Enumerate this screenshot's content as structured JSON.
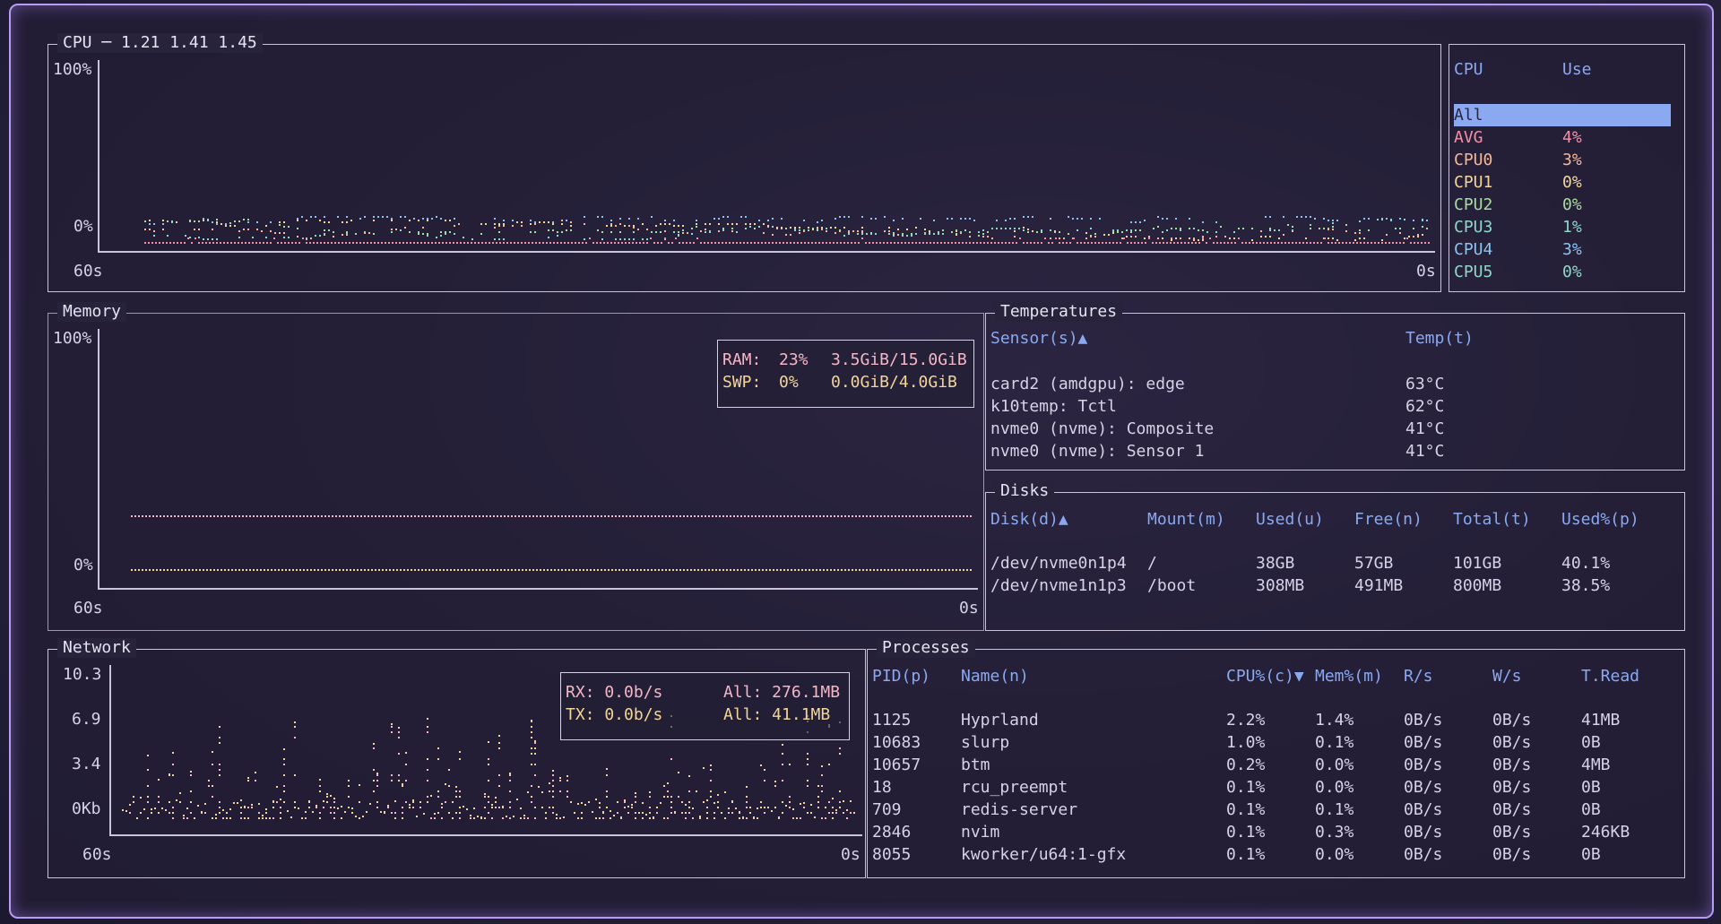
{
  "cpu_panel": {
    "title": "CPU ─ 1.21 1.41 1.45",
    "y_max": "100%",
    "y_min": "0%",
    "x_left": "60s",
    "x_right": "0s"
  },
  "cpu_list": {
    "col_cpu": "CPU",
    "col_use": "Use",
    "rows": [
      {
        "name": "All",
        "use": "",
        "selected": true,
        "color": "#8aa9f0"
      },
      {
        "name": "AVG",
        "use": "4%",
        "color": "#f58fa6"
      },
      {
        "name": "CPU0",
        "use": "3%",
        "color": "#f5b795"
      },
      {
        "name": "CPU1",
        "use": "0%",
        "color": "#f2d59a"
      },
      {
        "name": "CPU2",
        "use": "0%",
        "color": "#a8dca0"
      },
      {
        "name": "CPU3",
        "use": "1%",
        "color": "#8fd7c9"
      },
      {
        "name": "CPU4",
        "use": "3%",
        "color": "#8bc4f0"
      },
      {
        "name": "CPU5",
        "use": "0%",
        "color": "#8fd7c9"
      }
    ]
  },
  "memory_panel": {
    "title": "Memory",
    "y_max": "100%",
    "y_min": "0%",
    "x_left": "60s",
    "x_right": "0s",
    "ram_label": "RAM:",
    "ram_pct": "23%",
    "ram_amount": "3.5GiB/15.0GiB",
    "swp_label": "SWP:",
    "swp_pct": "0%",
    "swp_amount": "0.0GiB/4.0GiB"
  },
  "temps_panel": {
    "title": "Temperatures",
    "col_sensor": "Sensor(s)▲",
    "col_temp": "Temp(t)",
    "rows": [
      {
        "sensor": "card2 (amdgpu): edge",
        "temp": "63°C"
      },
      {
        "sensor": "k10temp: Tctl",
        "temp": "62°C"
      },
      {
        "sensor": "nvme0 (nvme): Composite",
        "temp": "41°C"
      },
      {
        "sensor": "nvme0 (nvme): Sensor 1",
        "temp": "41°C"
      }
    ]
  },
  "disks_panel": {
    "title": "Disks",
    "headers": [
      "Disk(d)▲",
      "Mount(m)",
      "Used(u)",
      "Free(n)",
      "Total(t)",
      "Used%(p)"
    ],
    "rows": [
      [
        "/dev/nvme0n1p4",
        "/",
        "38GB",
        "57GB",
        "101GB",
        "40.1%"
      ],
      [
        "/dev/nvme1n1p3",
        "/boot",
        "308MB",
        "491MB",
        "800MB",
        "38.5%"
      ]
    ]
  },
  "network_panel": {
    "title": "Network",
    "y_ticks": [
      "10.3",
      "6.9",
      "3.4",
      "0Kb"
    ],
    "x_left": "60s",
    "x_right": "0s",
    "rx_label": "RX: 0.0b/s",
    "rx_all": "All: 276.1MB",
    "tx_label": "TX: 0.0b/s",
    "tx_all": "All: 41.1MB"
  },
  "processes_panel": {
    "title": "Processes",
    "headers": [
      "PID(p)",
      "Name(n)",
      "CPU%(c)▼",
      "Mem%(m)",
      "R/s",
      "W/s",
      "T.Read"
    ],
    "rows": [
      [
        "1125",
        "Hyprland",
        "2.2%",
        "1.4%",
        "0B/s",
        "0B/s",
        "41MB"
      ],
      [
        "10683",
        "slurp",
        "1.0%",
        "0.1%",
        "0B/s",
        "0B/s",
        "0B"
      ],
      [
        "10657",
        "btm",
        "0.2%",
        "0.0%",
        "0B/s",
        "0B/s",
        "4MB"
      ],
      [
        "18",
        "rcu_preempt",
        "0.1%",
        "0.0%",
        "0B/s",
        "0B/s",
        "0B"
      ],
      [
        "709",
        "redis-server",
        "0.1%",
        "0.1%",
        "0B/s",
        "0B/s",
        "0B"
      ],
      [
        "2846",
        "nvim",
        "0.1%",
        "0.3%",
        "0B/s",
        "0B/s",
        "246KB"
      ],
      [
        "8055",
        "kworker/u64:1-gfx",
        "0.1%",
        "0.0%",
        "0B/s",
        "0B/s",
        "0B"
      ]
    ]
  },
  "colors": {
    "accent": "#8aa9f0",
    "border": "#c8c4de",
    "window_border": "#b79cf2",
    "ram": "#f5b7c6",
    "swap": "#f2d59a",
    "rx": "#f5b7c6",
    "tx": "#f2d59a"
  }
}
